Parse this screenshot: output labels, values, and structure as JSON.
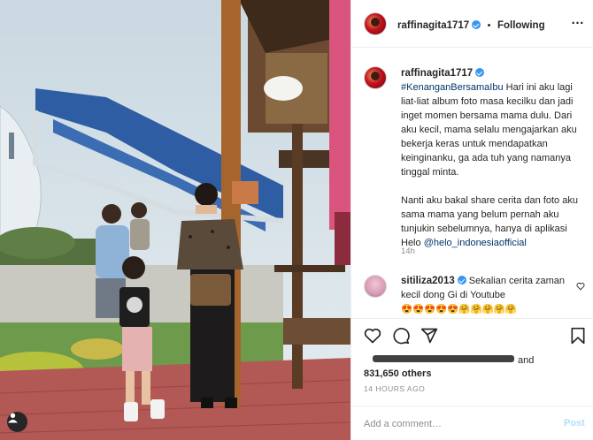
{
  "post": {
    "username": "raffinagita1717",
    "following_label": "Following",
    "more_label": "…",
    "separator": "•",
    "caption": {
      "hashtag": "#KenanganBersamaIbu",
      "text_1": " Hari ini aku lagi liat-liat album foto masa kecilku dan jadi inget momen bersama mama dulu. Dari aku kecil, mama selalu mengajarkan aku bekerja keras untuk mendapatkan keinginanku, ga ada tuh yang namanya tinggal minta.",
      "text_2": "Nanti aku bakal share cerita dan foto aku sama mama yang belum pernah aku tunjukin sebelumnya, hanya di aplikasi Helo ",
      "mention": "@helo_indonesiaofficial",
      "time_ago": "14h"
    },
    "comment": {
      "username": "sitiliza2013",
      "text": " Sekalian cerita zaman kecil dong Gi di Youtube",
      "emojis": "😍😍😍😍😍🤗🤗🤗🤗🤗"
    },
    "likes": {
      "and_label": "and",
      "count": "831,650 others"
    },
    "date": "14 HOURS AGO",
    "add_comment_placeholder": "Add a comment…",
    "post_button": "Post"
  },
  "icons": {
    "like": "heart-icon",
    "comment": "comment-icon",
    "share": "share-icon",
    "save": "bookmark-icon",
    "verified": "verified-badge-icon",
    "user_tag": "user-tag-icon"
  },
  "colors": {
    "verified": "#3897f0",
    "link": "#003569",
    "muted": "#8e8e8e",
    "post_button": "#b2dffc"
  }
}
